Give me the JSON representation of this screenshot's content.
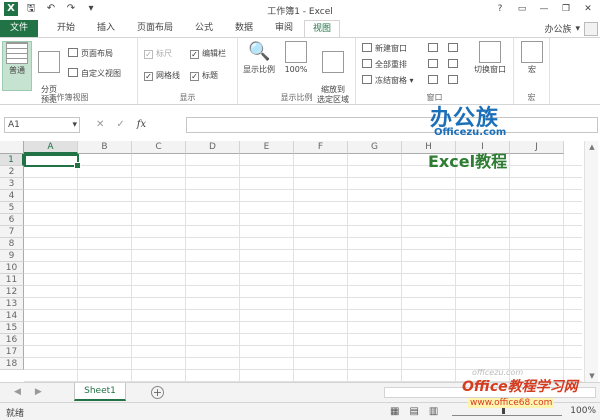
{
  "window": {
    "title": "工作簿1 - Excel",
    "controls": [
      "?",
      "▭",
      "—",
      "❐",
      "✕"
    ]
  },
  "qat": {
    "app_icon": "X",
    "save": "🖫",
    "undo": "↶",
    "redo": "↷",
    "customize": "▾"
  },
  "tabs": [
    "文件",
    "开始",
    "插入",
    "页面布局",
    "公式",
    "数据",
    "审阅",
    "视图"
  ],
  "active_tab": "视图",
  "user": {
    "name": "办公族"
  },
  "ribbon": {
    "views": {
      "label": "工作簿视图",
      "normal": "普通",
      "page_break": "分页\n预览",
      "page_layout": "页面布局",
      "custom_views": "自定义视图"
    },
    "show": {
      "label": "显示",
      "ruler": "标尺",
      "gridlines": "网格线",
      "formula_bar": "编辑栏",
      "headings": "标题"
    },
    "zoom": {
      "label": "显示比例",
      "zoom": "显示比例",
      "hundred": "100%",
      "zoom_selection": "缩放到\n选定区域"
    },
    "window": {
      "label": "窗口",
      "new_window": "新建窗口",
      "arrange_all": "全部重排",
      "freeze_panes": "冻结窗格",
      "switch_windows": "切换窗口"
    },
    "macros": {
      "label": "宏",
      "macros": "宏"
    }
  },
  "formula_bar": {
    "name_box": "A1",
    "cancel": "✕",
    "enter": "✓",
    "fx": "fx",
    "value": ""
  },
  "grid": {
    "columns": [
      "A",
      "B",
      "C",
      "D",
      "E",
      "F",
      "G",
      "H",
      "I",
      "J"
    ],
    "rows": [
      "1",
      "2",
      "3",
      "4",
      "5",
      "6",
      "7",
      "8",
      "9",
      "10",
      "11",
      "12",
      "13",
      "14",
      "15",
      "16",
      "17",
      "18"
    ],
    "active_cell": "A1"
  },
  "sheets": {
    "tabs": [
      "Sheet1"
    ],
    "active": "Sheet1",
    "add": "+"
  },
  "status": {
    "text": "就绪",
    "zoom_minus": "−",
    "zoom_plus": "+",
    "zoom_level": "100%"
  },
  "watermarks": {
    "brand": "办公族",
    "site": "Officezu.com",
    "course": "Excel教程",
    "footer": "Office教程学习网",
    "footer_url": "www.office68.com",
    "faint": "officezu.com"
  }
}
